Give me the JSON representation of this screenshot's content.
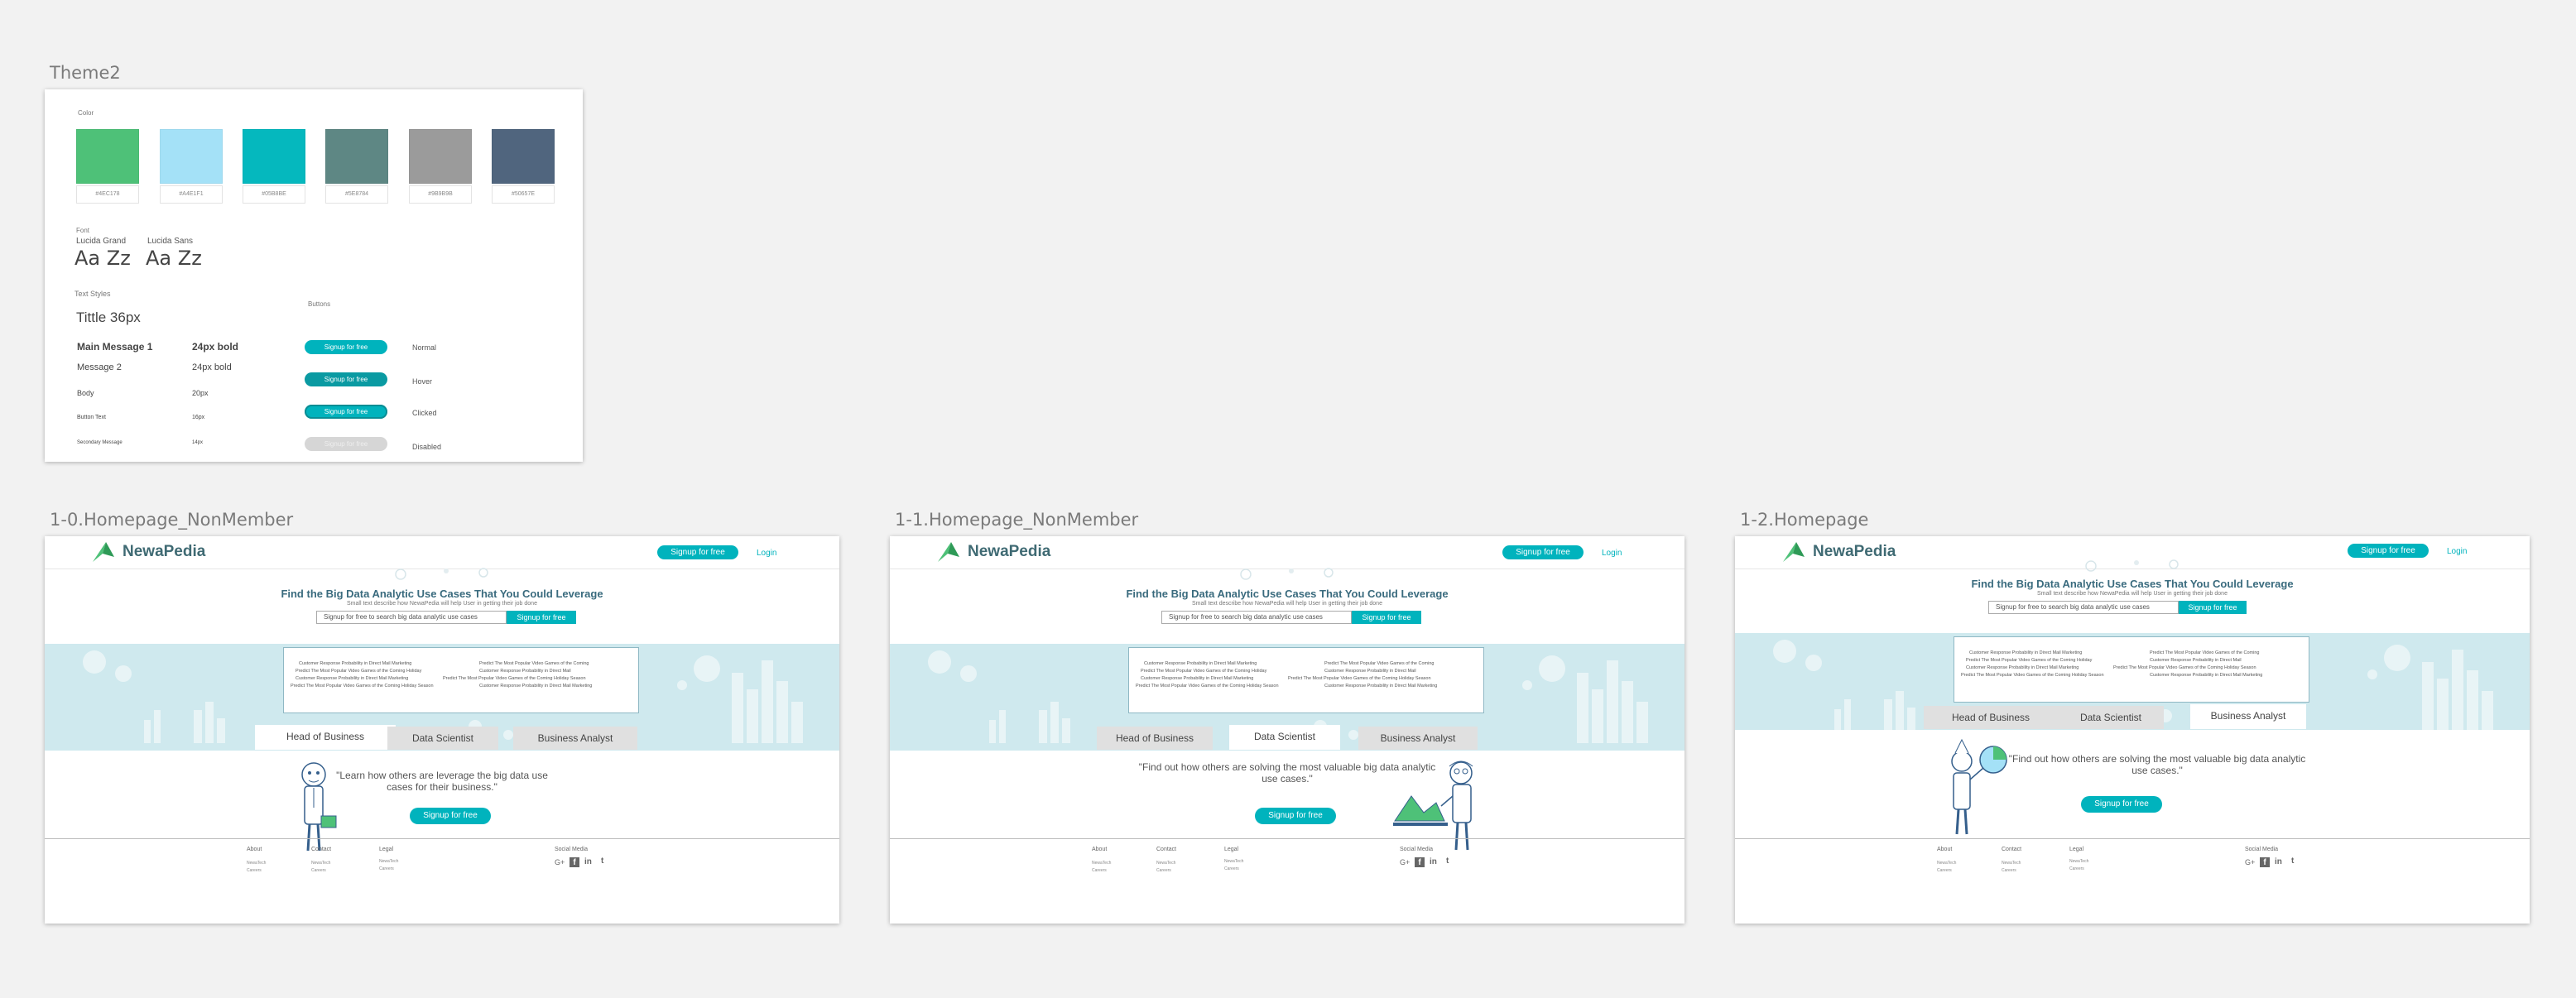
{
  "frames": {
    "theme_label": "Theme2",
    "hp0_label": "1-0.Homepage_NonMember",
    "hp1_label": "1-1.Homepage_NonMember",
    "hp2_label": "1-2.Homepage"
  },
  "theme": {
    "color_label": "Color",
    "swatches": [
      {
        "hex": "#4EC178",
        "color": "#4ec178"
      },
      {
        "hex": "#A4E1F1",
        "color": "#a4e1f7"
      },
      {
        "hex": "#05B8BE",
        "color": "#05b8be"
      },
      {
        "hex": "#5E8784",
        "color": "#5e8784"
      },
      {
        "hex": "#9B9B9B",
        "color": "#9b9b9b"
      },
      {
        "hex": "#50657E",
        "color": "#50657e"
      }
    ],
    "font_label": "Font",
    "fonts": [
      {
        "name": "Lucida Grand",
        "sample": "Aa Zz"
      },
      {
        "name": "Lucida Sans",
        "sample": "Aa Zz"
      }
    ],
    "text_styles_label": "Text Styles",
    "title_style": "Tittle 36px",
    "styles": [
      {
        "name": "Main Message 1",
        "spec": "24px bold"
      },
      {
        "name": "Message 2",
        "spec": "24px bold"
      },
      {
        "name": "Body",
        "spec": "20px"
      },
      {
        "name": "Button Text",
        "spec": "16px"
      },
      {
        "name": "Secondary Message",
        "spec": "14px"
      }
    ],
    "buttons_label": "Buttons",
    "buttons": [
      {
        "label": "Signup for free",
        "state": "Normal",
        "bg": "#00b3bd"
      },
      {
        "label": "Signup for free",
        "state": "Hover",
        "bg": "#0a9aa2"
      },
      {
        "label": "Signup for free",
        "state": "Clicked",
        "bg": "#00b3bd"
      },
      {
        "label": "Signup for free",
        "state": "Disabled",
        "bg": "#d6d6d6"
      }
    ]
  },
  "common": {
    "brand": "NewaPedia",
    "signup": "Signup for free",
    "login": "Login",
    "hero_title": "Find the Big Data Analytic Use Cases That You Could Leverage",
    "hero_sub": "Small text describe how NewaPedia will help User in getting their job done",
    "search_placeholder": "Signup for free to search big data analytic use cases",
    "search_button": "Signup for free",
    "tabs": [
      "Head of Business",
      "Data Scientist",
      "Business Analyst"
    ],
    "use_cases": [
      "Customer Response Probability in Direct Mail Marketing",
      "Predict The Most Popular Video Games of the Coming Holiday",
      "Customer Response Probability in Direct Mail Marketing",
      "Predict The Most Popular Video Games of the Coming Holiday Season",
      "Predict The Most Popular Video Games of the Coming",
      "Customer Response Probability in Direct Mail",
      "Predict The Most Popular Video Games of the Coming Holiday Season",
      "Customer Response Probability in Direct Mail Marketing"
    ],
    "footer": {
      "about": "About",
      "about_links": [
        "NewaTech",
        "Careers"
      ],
      "contact": "Contact",
      "contact_links": [
        "NewaTech",
        "Careers"
      ],
      "legal": "Legal",
      "legal_links": [
        "NewaTech",
        "Careers"
      ],
      "social": "Social Media",
      "social_icons": [
        "G+",
        "f",
        "in",
        "t"
      ]
    }
  },
  "hp0": {
    "quote": "\"Learn how others are leverage the big data use cases for their business.\""
  },
  "hp1": {
    "quote": "\"Find out how others are solving the most valuable big data analytic use cases.\""
  },
  "hp2": {
    "quote": "\"Find out how others are solving the most valuable big data analytic use cases.\""
  }
}
